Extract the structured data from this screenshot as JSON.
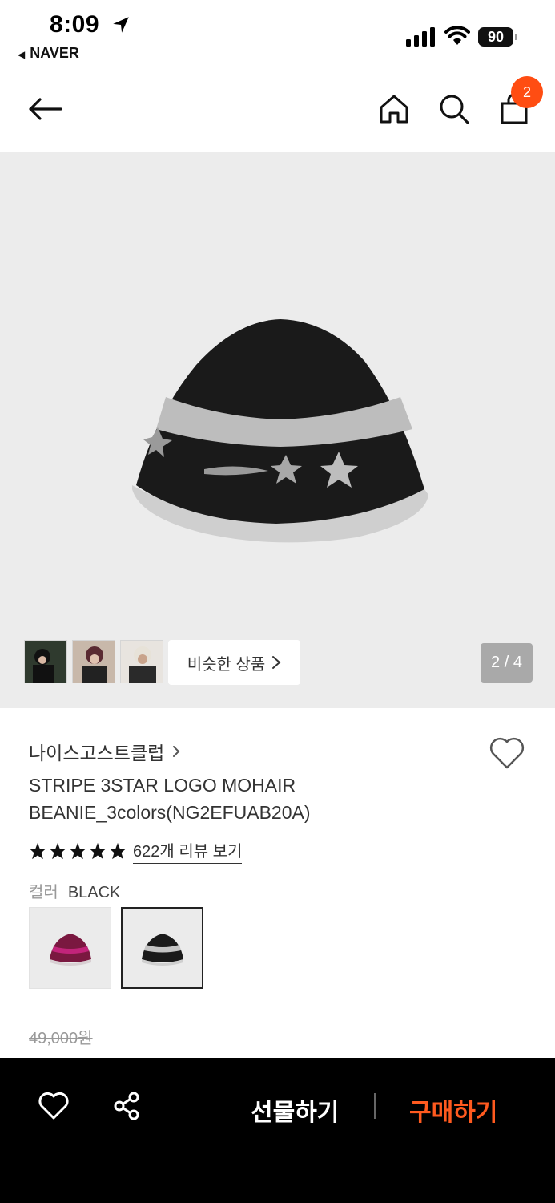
{
  "status_bar": {
    "time": "8:09",
    "back_app": "NAVER",
    "battery": "90"
  },
  "header": {
    "cart_count": "2"
  },
  "gallery": {
    "similar_label": "비슷한 상품",
    "counter": "2 / 4"
  },
  "product": {
    "brand": "나이스고스트클럽",
    "title": "STRIPE 3STAR LOGO MOHAIR BEANIE_3colors(NG2EFUAB20A)",
    "stars": 5,
    "review_link": "622개 리뷰 보기",
    "color_label": "컬러",
    "color_value": "BLACK",
    "original_price": "49,000원"
  },
  "bottom_bar": {
    "gift_label": "선물하기",
    "buy_label": "구매하기"
  },
  "colors": {
    "accent": "#ff4d12",
    "buy": "#ff5a1f",
    "bottom_bar_bg": "#000000",
    "gallery_bg": "#ececec"
  },
  "icons": [
    "location-arrow-icon",
    "signal-icon",
    "wifi-icon",
    "battery-icon",
    "back-arrow-icon",
    "home-icon",
    "search-icon",
    "cart-icon",
    "chevron-right-icon",
    "heart-icon",
    "star-icon",
    "share-icon"
  ]
}
